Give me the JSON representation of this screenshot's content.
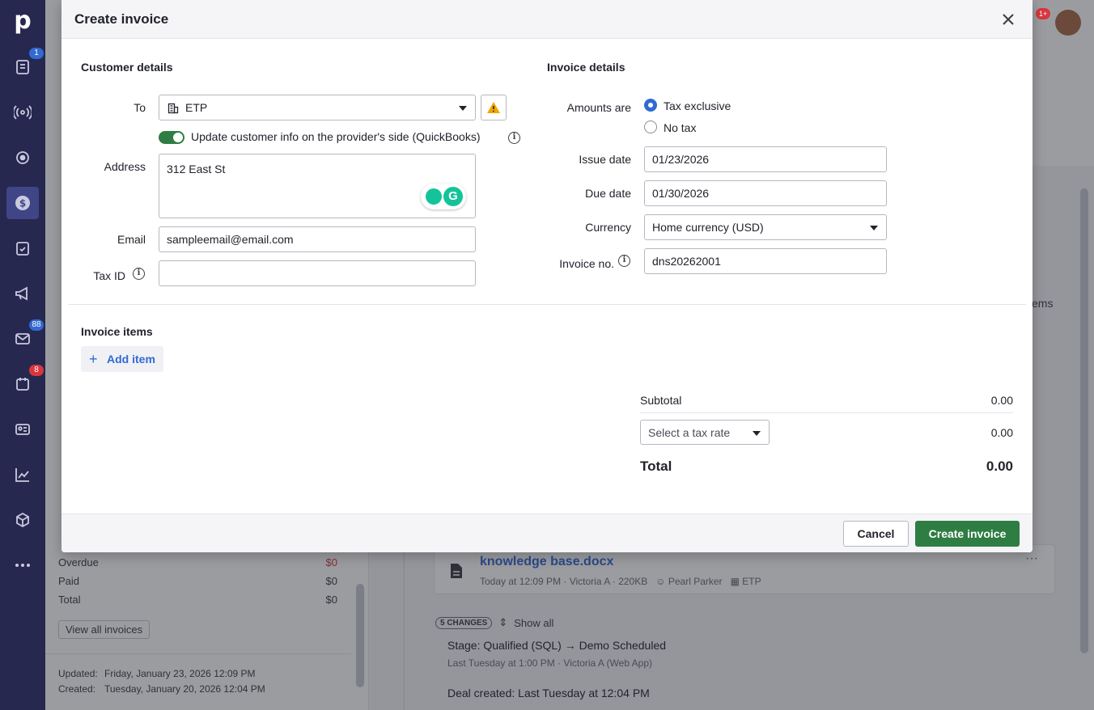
{
  "nav": {
    "logo": "p",
    "items": [
      {
        "icon": "leads-icon",
        "badge": "1",
        "badge_color": "#3269d3"
      },
      {
        "icon": "signal-icon",
        "badge": ""
      },
      {
        "icon": "target-icon",
        "badge": ""
      },
      {
        "icon": "dollar-icon",
        "badge": "",
        "active": true
      },
      {
        "icon": "clipboard-check-icon",
        "badge": ""
      },
      {
        "icon": "megaphone-icon",
        "badge": ""
      },
      {
        "icon": "mail-icon",
        "badge": "88",
        "badge_color": "#3269d3"
      },
      {
        "icon": "calendar-icon",
        "badge": "8",
        "badge_color": "#d9363e"
      },
      {
        "icon": "contact-card-icon",
        "badge": ""
      },
      {
        "icon": "chart-icon",
        "badge": ""
      },
      {
        "icon": "box-icon",
        "badge": ""
      },
      {
        "icon": "more-icon",
        "badge": ""
      }
    ]
  },
  "background": {
    "notif_badge": "1+",
    "invoices": [
      {
        "label": "Overdue",
        "value": "$0",
        "red": true
      },
      {
        "label": "Paid",
        "value": "$0"
      },
      {
        "label": "Total",
        "value": "$0"
      }
    ],
    "view_all_label": "View all invoices",
    "updated_label": "Updated:",
    "updated_value": "Friday, January 23, 2026 12:09 PM",
    "created_label": "Created:",
    "created_value": "Tuesday, January 20, 2026 12:04 PM",
    "file": {
      "name": "knowledge base.docx",
      "meta": "Today at 12:09 PM · Victoria A · 220KB",
      "person": "Pearl Parker",
      "org": "ETP"
    },
    "changes_pill": "5 CHANGES",
    "show_all": "Show all",
    "history": [
      {
        "title": "Stage: Qualified (SQL) → Demo Scheduled",
        "sub": "Last Tuesday at 1:00 PM · Victoria A (Web App)"
      },
      {
        "title": "Deal created: Last Tuesday at 12:04 PM",
        "sub": ""
      }
    ],
    "items_peek": "items"
  },
  "modal": {
    "title": "Create invoice",
    "customer": {
      "section_title": "Customer details",
      "to_label": "To",
      "to_value": "ETP",
      "toggle_label": "Update customer info on the provider's side (QuickBooks)",
      "address_label": "Address",
      "address_value": "312 East St",
      "email_label": "Email",
      "email_value": "sampleemail@email.com",
      "taxid_label": "Tax ID",
      "taxid_value": ""
    },
    "invoice": {
      "section_title": "Invoice details",
      "amounts_label": "Amounts are",
      "radio_tax_exclusive": "Tax exclusive",
      "radio_no_tax": "No tax",
      "issue_label": "Issue date",
      "issue_value": "01/23/2026",
      "due_label": "Due date",
      "due_value": "01/30/2026",
      "currency_label": "Currency",
      "currency_value": "Home currency (USD)",
      "number_label": "Invoice no.",
      "number_value": "dns20262001"
    },
    "items": {
      "section_title": "Invoice items",
      "add_item_label": "Add item"
    },
    "totals": {
      "subtotal_label": "Subtotal",
      "subtotal_value": "0.00",
      "tax_placeholder": "Select a tax rate",
      "tax_value": "0.00",
      "total_label": "Total",
      "total_value": "0.00"
    },
    "footer": {
      "cancel_label": "Cancel",
      "create_label": "Create invoice"
    }
  }
}
